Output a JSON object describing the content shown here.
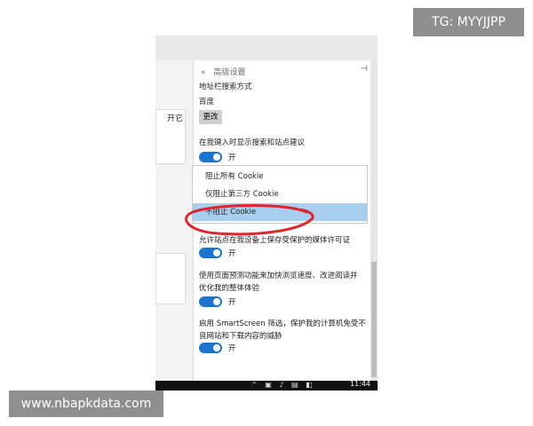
{
  "watermarks": {
    "tg": "TG: MYYJJPP",
    "site": "www.nbapkdata.com"
  },
  "left_partial_text": "开它",
  "panel": {
    "back_glyph": "«",
    "title": "高级设置",
    "pin_glyph": "⊣",
    "address_bar_label": "地址栏搜索方式",
    "address_bar_value": "百度",
    "change_button": "更改",
    "suggestions_label": "在我键入时显示搜索和站点建议",
    "suggestions_state": "开",
    "cookie_options": [
      "阻止所有 Cookie",
      "仅阻止第三方 Cookie",
      "不阻止 Cookie"
    ],
    "cookie_selected_index": 2,
    "media_license_label": "允许站点在我设备上保存受保护的媒体许可证",
    "media_license_state": "开",
    "prediction_label_line1": "使用页面预测功能来加快浏览速度、改进阅读并",
    "prediction_label_line2": "优化我的整体体验",
    "prediction_state": "开",
    "smartscreen_label_line1": "启用 SmartScreen 筛选，保护我的计算机免受不",
    "smartscreen_label_line2": "良网站和下载内容的威胁",
    "smartscreen_state": "开"
  },
  "taskbar": {
    "time": "11:44"
  },
  "colors": {
    "toggle_on": "#1b75d0",
    "selection": "#a8cff0",
    "annotation_circle": "#e0262b"
  }
}
